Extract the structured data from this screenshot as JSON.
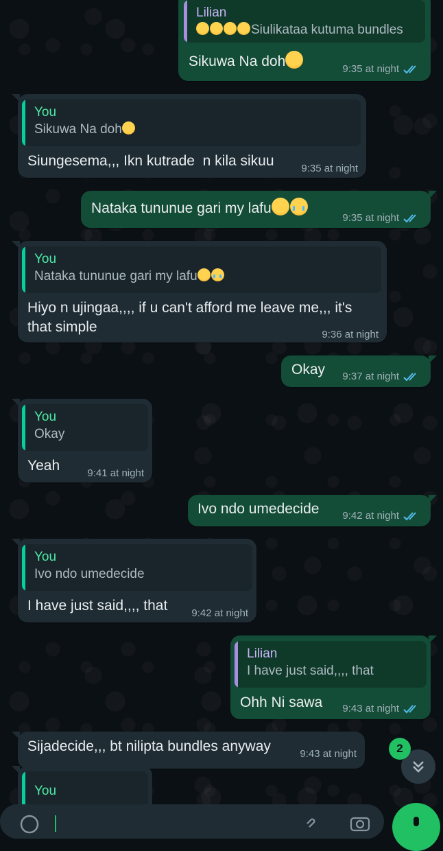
{
  "messages": [
    {
      "quote_name": "Lilian",
      "quote_text": "Siulikataa  kutuma bundles",
      "text": "Sikuwa Na doh",
      "time": "9:35 at night"
    },
    {
      "quote_name": "You",
      "quote_text": "Sikuwa Na doh",
      "text": "Siungesema,,, Ikn kutrade  n kila sikuu",
      "time": "9:35 at night"
    },
    {
      "text": "Nataka tununue gari my lafu",
      "time": "9:35 at night"
    },
    {
      "quote_name": "You",
      "quote_text": "Nataka tununue gari my lafu",
      "text": "Hiyo n ujingaa,,,, if u can't afford me leave me,,, it's\nthat simple",
      "time": "9:36 at night"
    },
    {
      "text": "Okay",
      "time": "9:37 at night"
    },
    {
      "quote_name": "You",
      "quote_text": "Okay",
      "text": "Yeah",
      "time": "9:41 at night"
    },
    {
      "text": "Ivo ndo umedecide",
      "time": "9:42 at night"
    },
    {
      "quote_name": "You",
      "quote_text": "Ivo ndo umedecide",
      "text": "I have just said,,,, that",
      "time": "9:42 at night"
    },
    {
      "quote_name": "Lilian",
      "quote_text": "I have just said,,,, that",
      "text": "Ohh Ni sawa",
      "time": "9:43 at night"
    },
    {
      "text": "Sijadecide,,, bt nilipta bundles anyway",
      "time": "9:43 at night"
    },
    {
      "quote_name": "You"
    }
  ],
  "unread_count": "2",
  "colors": {
    "outgoing_bubble": "#144d37",
    "incoming_bubble": "#1f2c34",
    "accent_green": "#21c063",
    "read_ticks": "#53bdeb"
  },
  "icons": [
    "double-check-icon",
    "chevron-double-down-icon",
    "emoji-icon",
    "attach-icon",
    "camera-icon",
    "mic-icon"
  ]
}
